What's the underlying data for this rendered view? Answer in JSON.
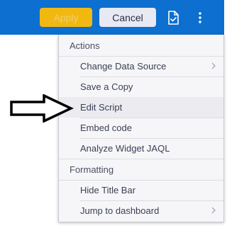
{
  "toolbar": {
    "apply_label": "Apply",
    "cancel_label": "Cancel",
    "save_icon": "document-check-icon",
    "more_icon": "more-vertical-icon",
    "background_color": "#0d6fcf",
    "apply_color": "#f2b812"
  },
  "menu": {
    "sections": [
      {
        "header": "Actions",
        "items": [
          {
            "label": "Change Data Source",
            "submenu": true
          },
          {
            "label": "Save a Copy",
            "submenu": false
          },
          {
            "label": "Edit Script",
            "submenu": false,
            "highlighted": true
          },
          {
            "label": "Embed code",
            "submenu": false
          },
          {
            "label": "Analyze Widget JAQL",
            "submenu": false
          }
        ]
      },
      {
        "header": "Formatting",
        "items": [
          {
            "label": "Hide Title Bar",
            "submenu": false
          },
          {
            "label": "Jump to dashboard",
            "submenu": true
          }
        ]
      }
    ]
  },
  "annotation": {
    "pointer_icon": "pointing-arrow-icon",
    "points_to": "Edit Script"
  }
}
